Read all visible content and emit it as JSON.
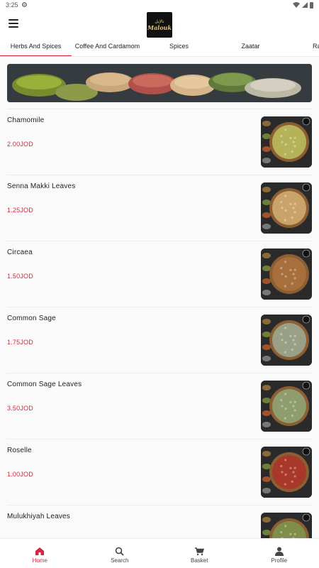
{
  "status_bar": {
    "time": "3:25",
    "icons": [
      "settings-icon",
      "wifi-icon",
      "signal-icon",
      "battery-icon"
    ]
  },
  "header": {
    "logo_top": "تالإبل",
    "logo_main": "Malouk"
  },
  "tabs": [
    {
      "label": "Herbs And Spices",
      "active": true
    },
    {
      "label": "Coffee And Cardamom",
      "active": false
    },
    {
      "label": "Spices",
      "active": false
    },
    {
      "label": "Zaatar",
      "active": false
    },
    {
      "label": "Raw",
      "active": false
    }
  ],
  "products": [
    {
      "name": "Chamomile",
      "price": "2.00JOD",
      "color": "#b5b35a"
    },
    {
      "name": "Senna Makki Leaves",
      "price": "1.25JOD",
      "color": "#c9a36a"
    },
    {
      "name": "Circaea",
      "price": "1.50JOD",
      "color": "#a66f3c"
    },
    {
      "name": "Common Sage",
      "price": "1.75JOD",
      "color": "#9aa085"
    },
    {
      "name": "Common Sage Leaves",
      "price": "3.50JOD",
      "color": "#8f9c6e"
    },
    {
      "name": "Roselle",
      "price": "1.00JOD",
      "color": "#a8392a"
    },
    {
      "name": "Mulukhiyah Leaves",
      "price": "",
      "color": "#7f8f4a"
    }
  ],
  "colors": {
    "accent": "#d7263d",
    "text": "#222222"
  },
  "bottom_nav": [
    {
      "label": "Home",
      "icon": "home-icon",
      "active": true
    },
    {
      "label": "Search",
      "icon": "search-icon",
      "active": false
    },
    {
      "label": "Basket",
      "icon": "basket-icon",
      "active": false
    },
    {
      "label": "Profile",
      "icon": "profile-icon",
      "active": false
    }
  ]
}
